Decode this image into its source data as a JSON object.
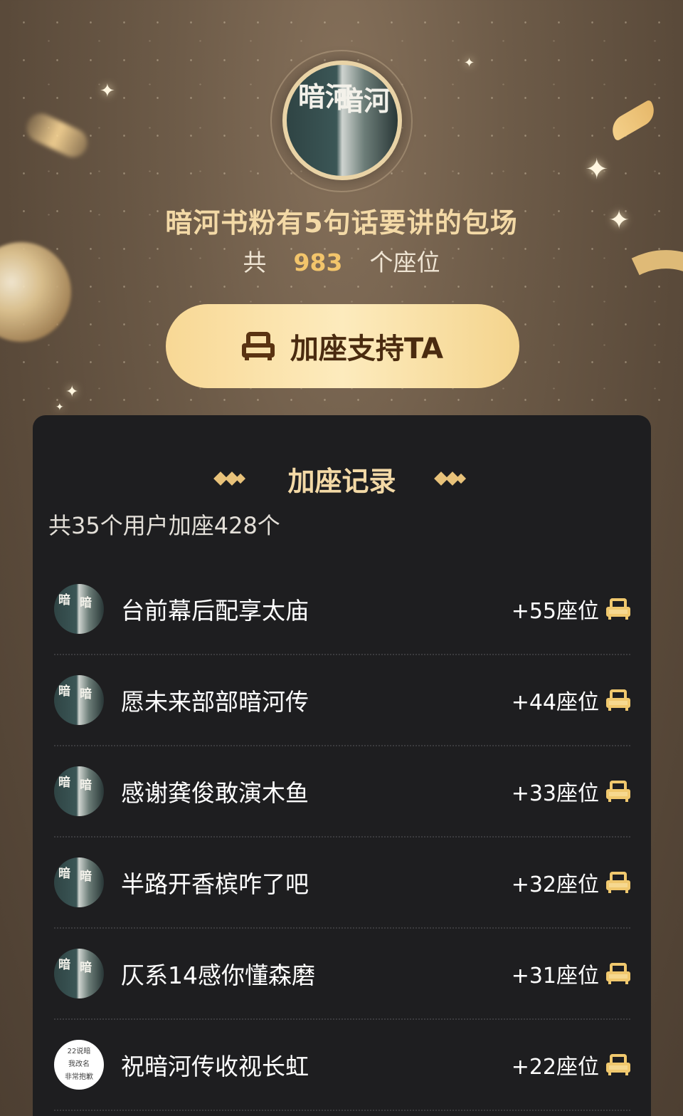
{
  "header": {
    "title": "暗河书粉有5句话要讲的包场",
    "seats_prefix": "共",
    "seats_total": "983",
    "seats_suffix": "个座位",
    "cta_label": "加座支持TA",
    "avatar_text_left": "暗河",
    "avatar_text_right": "暗河"
  },
  "records": {
    "title": "加座记录",
    "summary": "共35个用户加座428个",
    "items": [
      {
        "name": "台前幕后配享太庙",
        "count": "+55座位",
        "avatar": "book-cover"
      },
      {
        "name": "愿未来部部暗河传",
        "count": "+44座位",
        "avatar": "book-cover"
      },
      {
        "name": "感谢龚俊敢演木鱼",
        "count": "+33座位",
        "avatar": "book-cover"
      },
      {
        "name": "半路开香槟咋了吧",
        "count": "+32座位",
        "avatar": "book-cover"
      },
      {
        "name": "仄系14感你懂森磨",
        "count": "+31座位",
        "avatar": "book-cover"
      },
      {
        "name": "祝暗河传收视长虹",
        "count": "+22座位",
        "avatar": "text",
        "avatar_lines": [
          "22说暗",
          "我改名",
          "非常抱歉"
        ]
      }
    ]
  },
  "icons": {
    "cta_icon": "sofa-icon",
    "seat_icon": "sofa-icon",
    "title_decoration": "diamond-icon"
  },
  "colors": {
    "accent_gold": "#f3c56b",
    "title_gold": "#f3d9a6",
    "cta_gradient_start": "#f8d895",
    "panel_bg": "#1e1e20"
  }
}
